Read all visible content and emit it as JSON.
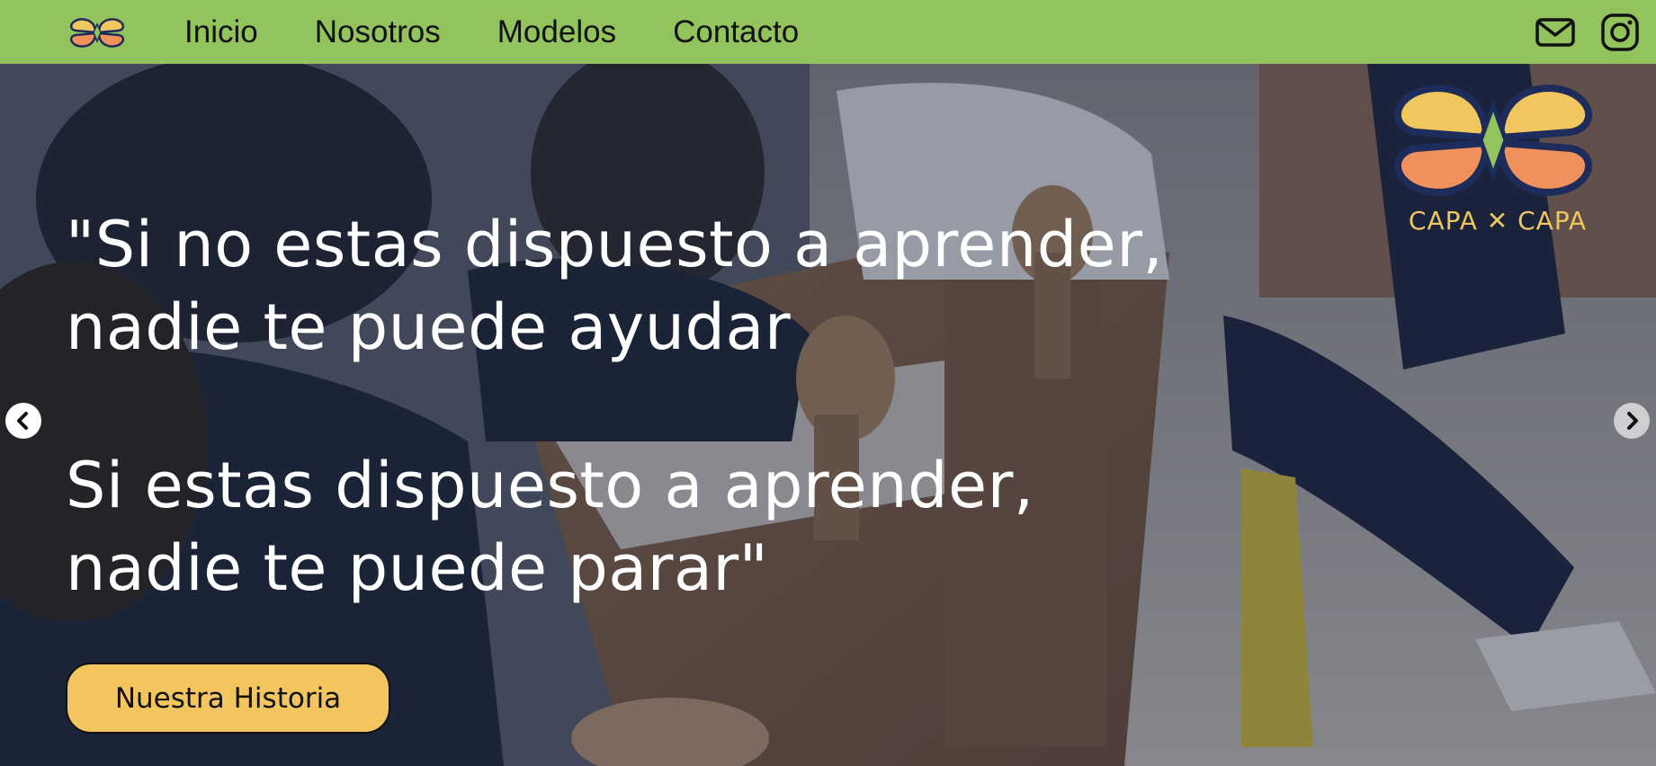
{
  "nav": {
    "logo_icon": "capa-x-capa-logo-icon",
    "links": [
      "Inicio",
      "Nosotros",
      "Modelos",
      "Contacto"
    ],
    "icons": [
      "mail-icon",
      "instagram-icon"
    ]
  },
  "hero": {
    "quote_line_1": "\"Si no estas dispuesto a aprender,",
    "quote_line_2": "nadie te puede ayudar",
    "quote_line_3": "Si estas dispuesto a aprender,",
    "quote_line_4": "nadie te puede parar\"",
    "cta_label": "Nuestra Historia",
    "brand_name": "CAPA ✕ CAPA",
    "prev_icon": "chevron-left-icon",
    "next_icon": "chevron-right-icon"
  },
  "colors": {
    "nav_bg": "#93c35c",
    "cta_bg": "#f2c55f",
    "brand_yellow": "#f0c75e",
    "brand_orange": "#f0905a",
    "brand_navy": "#1d2c5a",
    "brand_green": "#93c35c"
  }
}
